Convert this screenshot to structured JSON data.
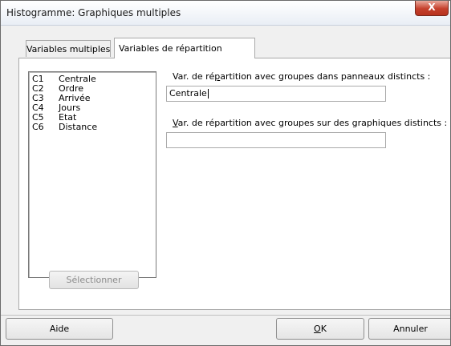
{
  "window": {
    "title": "Histogramme: Graphiques multiples",
    "close_glyph": "X"
  },
  "tabs": [
    {
      "label": "Variables multiples",
      "selected": false
    },
    {
      "label": "Variables de répartition",
      "selected": true
    }
  ],
  "variables": [
    {
      "num": "C1",
      "name": "Centrale"
    },
    {
      "num": "C2",
      "name": "Ordre"
    },
    {
      "num": "C3",
      "name": "Arrivée"
    },
    {
      "num": "C4",
      "name": "Jours"
    },
    {
      "num": "C5",
      "name": "Etat"
    },
    {
      "num": "C6",
      "name": "Distance"
    }
  ],
  "select_button": "Sélectionner",
  "panels_field": {
    "label_pre": "Var. de ré",
    "label_key": "p",
    "label_post": "artition avec groupes dans panneaux distincts :",
    "value": "Centrale"
  },
  "graphs_field": {
    "label_key": "V",
    "label_post": "ar. de répartition avec groupes sur des graphiques distincts :",
    "value": ""
  },
  "buttons": {
    "help": "Aide",
    "ok_key": "O",
    "ok_rest": "K",
    "cancel": "Annuler"
  }
}
